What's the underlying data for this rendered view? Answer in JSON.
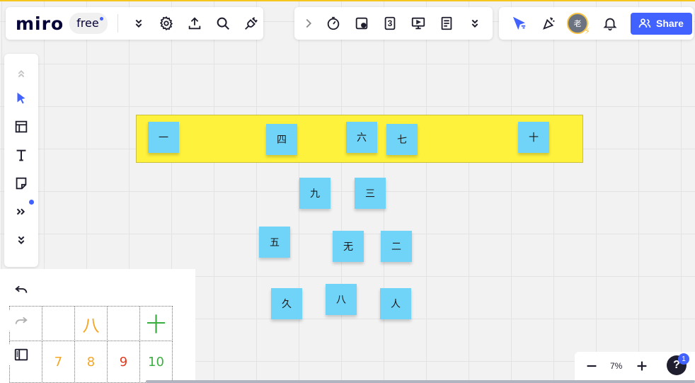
{
  "app": {
    "logo": "miro",
    "plan": "free"
  },
  "top_left_toolbar": {
    "icons": [
      "chevron-double-down-icon",
      "gear-icon",
      "upload-icon",
      "search-icon",
      "plug-icon"
    ]
  },
  "top_center_toolbar": {
    "icons": [
      "chevron-right-icon",
      "timer-icon",
      "sticky-note-tool-icon",
      "countdown-icon",
      "presentation-icon",
      "notes-icon",
      "chevron-double-down-icon"
    ],
    "countdown_label": "3"
  },
  "top_right_toolbar": {
    "avatar_initial": "老",
    "share_label": "Share"
  },
  "frame": {
    "color": "#fff23c"
  },
  "stickies": [
    {
      "text": "一"
    },
    {
      "text": "四"
    },
    {
      "text": "六"
    },
    {
      "text": "七"
    },
    {
      "text": "十"
    },
    {
      "text": "九"
    },
    {
      "text": "三"
    },
    {
      "text": "五"
    },
    {
      "text": "无"
    },
    {
      "text": "二"
    },
    {
      "text": "久"
    },
    {
      "text": "八"
    },
    {
      "text": "人"
    }
  ],
  "table": {
    "row1": [
      "",
      "",
      "八",
      "",
      "十"
    ],
    "row2": [
      "",
      "7",
      "8",
      "9",
      "10"
    ],
    "colors": [
      "#333333",
      "#333333",
      "#f5a623",
      "#333333",
      "#3cb043"
    ],
    "row2_colors": [
      "#333333",
      "#f5a623",
      "#f5a623",
      "#e03a1e",
      "#3cb043"
    ]
  },
  "zoom": {
    "level": "7%",
    "help_badge": "1"
  },
  "colors": {
    "accent": "#4262ff",
    "sticky": "#70d4f8"
  }
}
